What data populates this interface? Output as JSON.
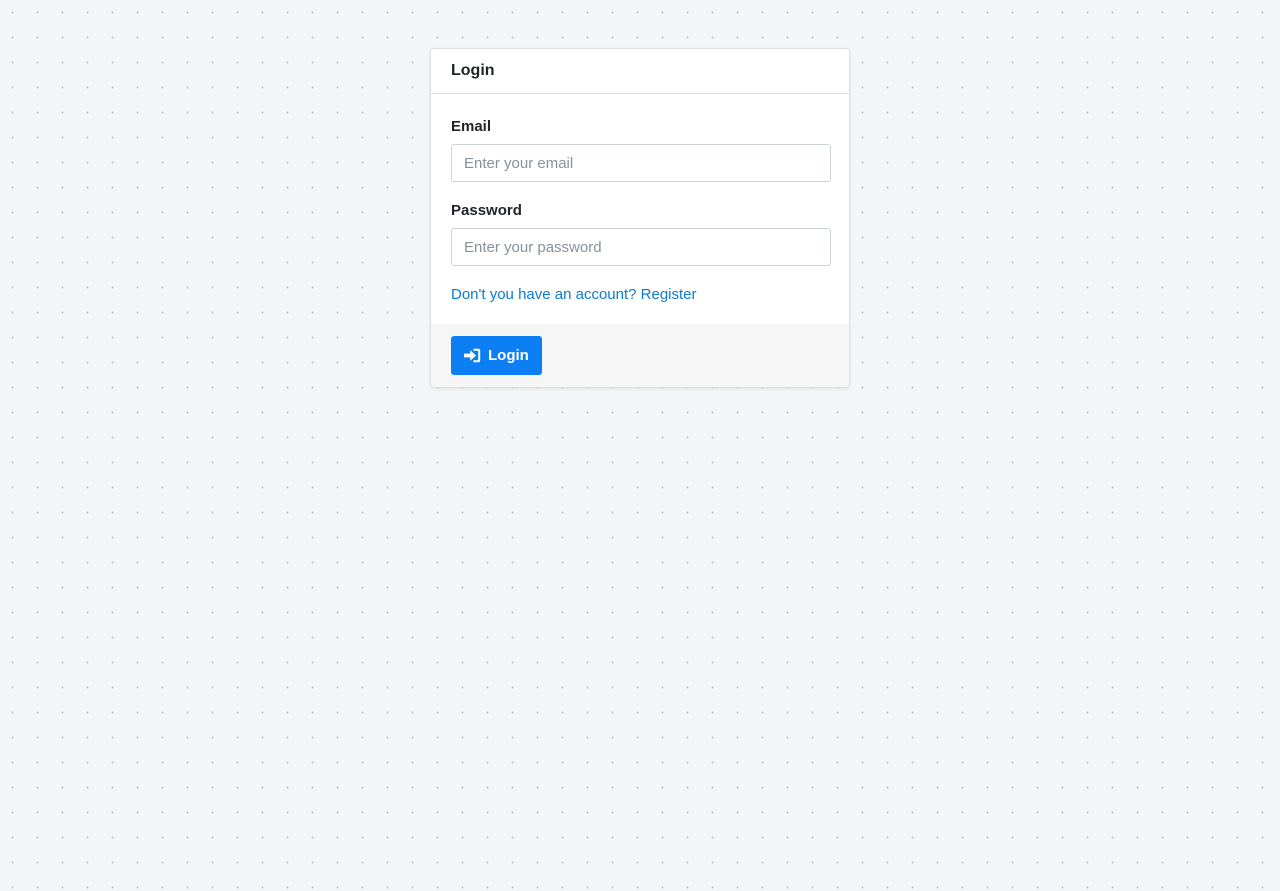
{
  "login_card": {
    "title": "Login",
    "email": {
      "label": "Email",
      "placeholder": "Enter your email",
      "value": ""
    },
    "password": {
      "label": "Password",
      "placeholder": "Enter your password",
      "value": ""
    },
    "register_link": "Don't you have an account? Register",
    "submit": {
      "label": "Login",
      "icon": "sign-in-icon"
    }
  },
  "colors": {
    "accent": "#0d7ff5",
    "link": "#0b7bd3",
    "background": "#f3f5f9"
  }
}
